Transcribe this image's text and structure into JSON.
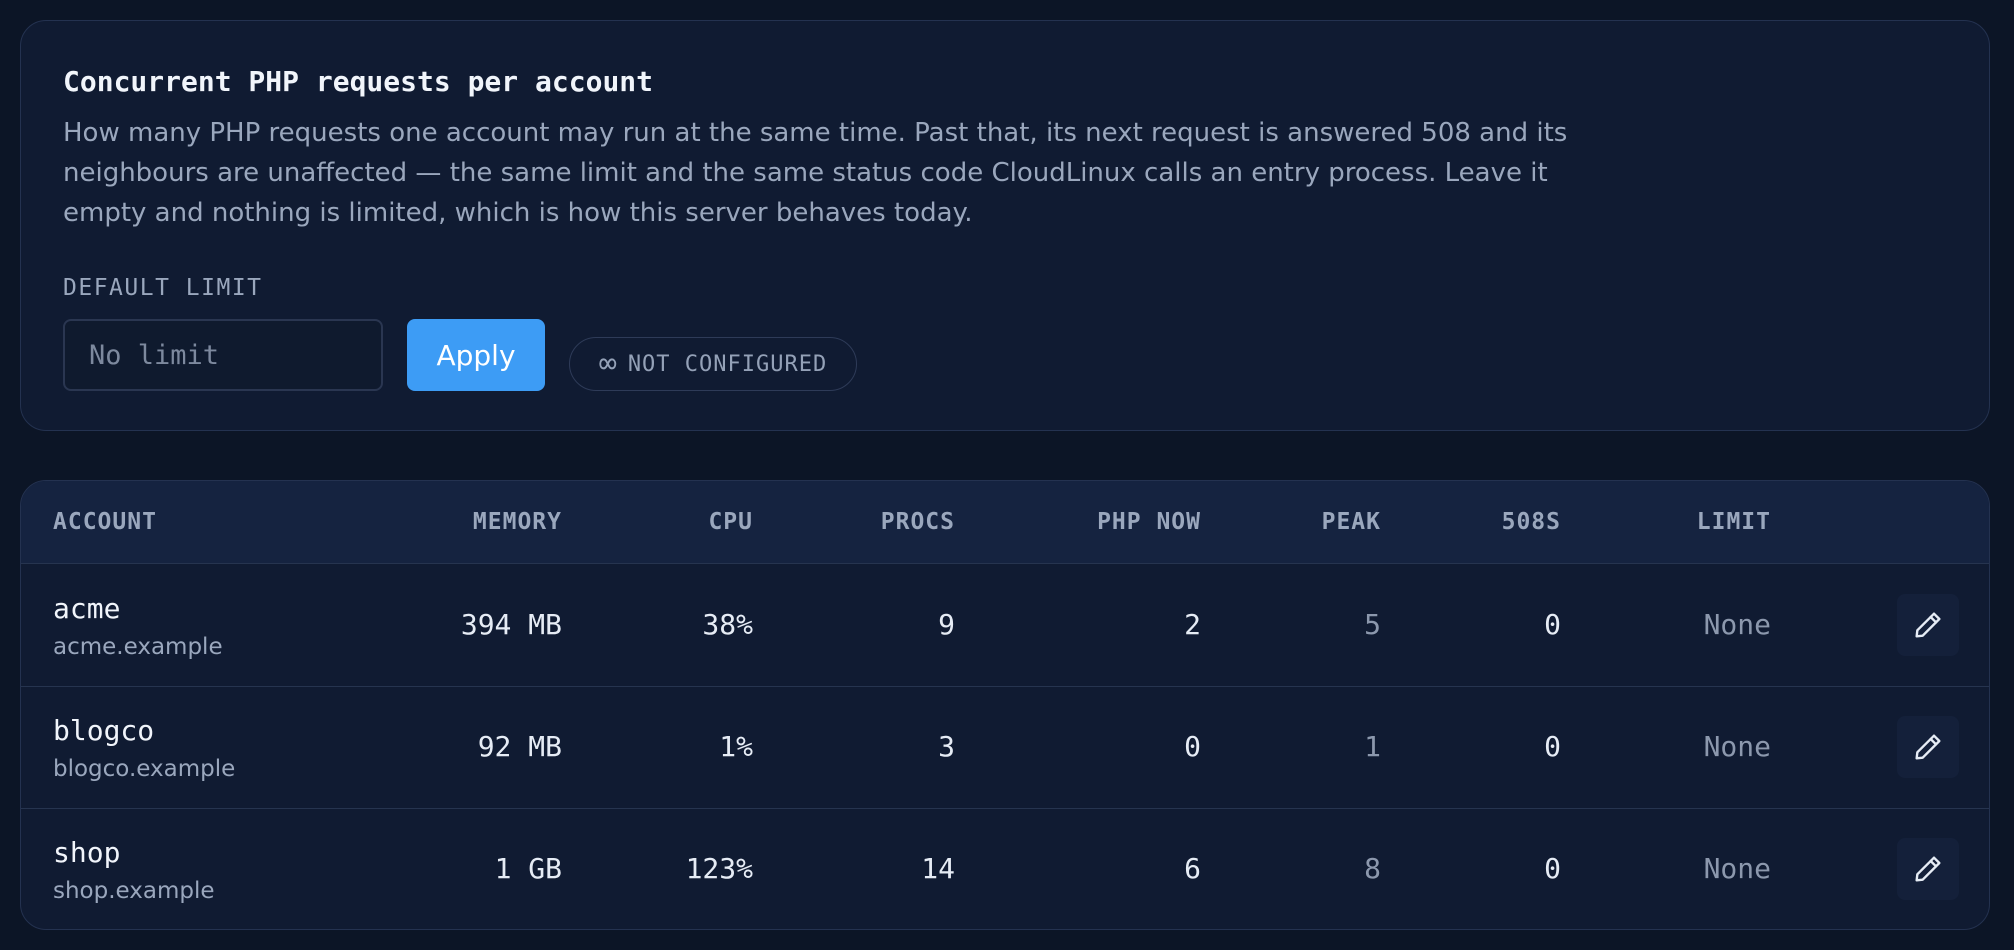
{
  "settings": {
    "title": "Concurrent PHP requests per account",
    "description": "How many PHP requests one account may run at the same time. Past that, its next request is answered 508 and its neighbours are unaffected — the same limit and the same status code CloudLinux calls an entry process. Leave it empty and nothing is limited, which is how this server behaves today.",
    "default_limit_label": "DEFAULT LIMIT",
    "limit_input_value": "",
    "limit_input_placeholder": "No limit",
    "apply_label": "Apply",
    "status_icon": "infinity-icon",
    "status_text": "NOT CONFIGURED"
  },
  "table": {
    "columns": [
      "ACCOUNT",
      "MEMORY",
      "CPU",
      "PROCS",
      "PHP NOW",
      "PEAK",
      "508S",
      "LIMIT"
    ],
    "rows": [
      {
        "name": "acme",
        "domain": "acme.example",
        "memory": "394 MB",
        "cpu": "38%",
        "procs": "9",
        "php_now": "2",
        "peak": "5",
        "s508": "0",
        "limit": "None"
      },
      {
        "name": "blogco",
        "domain": "blogco.example",
        "memory": "92 MB",
        "cpu": "1%",
        "procs": "3",
        "php_now": "0",
        "peak": "1",
        "s508": "0",
        "limit": "None"
      },
      {
        "name": "shop",
        "domain": "shop.example",
        "memory": "1 GB",
        "cpu": "123%",
        "procs": "14",
        "php_now": "6",
        "peak": "8",
        "s508": "0",
        "limit": "None"
      }
    ],
    "edit_icon": "pencil-icon"
  },
  "colors": {
    "background": "#0c1526",
    "card": "#101b32",
    "accent": "#3d9cf5",
    "text_muted": "#9aa7bd"
  }
}
